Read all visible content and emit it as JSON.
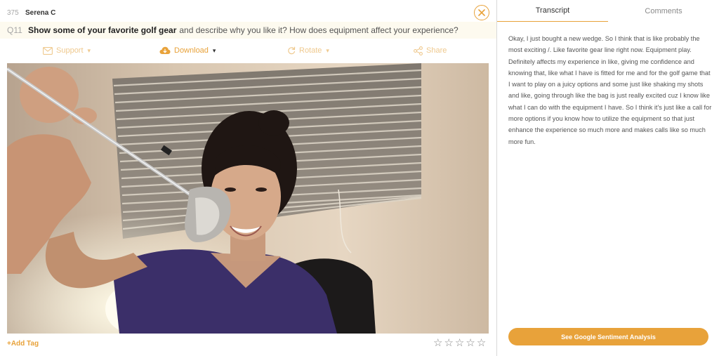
{
  "respondent": {
    "number": "375",
    "name": "Serena C"
  },
  "question": {
    "id": "Q11",
    "bold_text": "Show some of your favorite golf gear",
    "rest_text": "and describe why you like it? How does equipment affect your experience?"
  },
  "toolbar": {
    "support": {
      "label": "Support",
      "icon": "envelope-icon"
    },
    "download": {
      "label": "Download",
      "icon": "cloud-download-icon"
    },
    "rotate": {
      "label": "Rotate",
      "icon": "rotate-icon"
    },
    "share": {
      "label": "Share",
      "icon": "share-icon"
    }
  },
  "video": {
    "description_icon": "video-frame"
  },
  "footer": {
    "add_tag": "+Add Tag",
    "rating": 0,
    "rating_max": 5
  },
  "tabs": [
    {
      "label": "Transcript",
      "active": true
    },
    {
      "label": "Comments",
      "active": false
    }
  ],
  "transcript_text": "Okay, I just bought a new wedge. So I think that is like probably the most exciting /. Like favorite gear line right now. Equipment play. Definitely affects my experience in like, giving me confidence and knowing that, like what I have is fitted for me and for the golf game that I want to play on a juicy options and some just like shaking my shots and like, going through like the bag is just really excited cuz I know like what I can do with the equipment I have. So I think it's just like a call for more options if you know how to utilize the equipment so that just enhance the experience so much more and makes calls like so much more fun.",
  "sentiment_button": "See Google Sentiment Analysis",
  "colors": {
    "accent": "#e8a23a",
    "accent_muted": "#efc98e",
    "question_bg": "#fdfaef"
  }
}
